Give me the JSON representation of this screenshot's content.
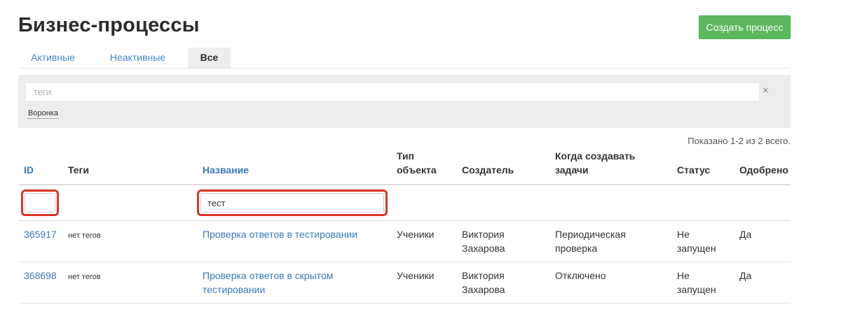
{
  "header": {
    "title": "Бизнес-процессы",
    "create_button": "Создать процесс"
  },
  "tabs": [
    {
      "label": "Активные",
      "active": false
    },
    {
      "label": "Неактивные",
      "active": false
    },
    {
      "label": "Все",
      "active": true
    }
  ],
  "filter": {
    "tags_placeholder": "теги",
    "clear_symbol": "×",
    "funnel_tag": "Воронка"
  },
  "summary": "Показано 1-2 из 2 всего.",
  "table": {
    "columns": {
      "id": "ID",
      "tags": "Теги",
      "name": "Название",
      "object_type": "Тип объекта",
      "creator": "Создатель",
      "when": "Когда создавать задачи",
      "status": "Статус",
      "approved": "Одобрено"
    },
    "filters": {
      "id_value": "",
      "name_value": "тест"
    },
    "rows": [
      {
        "id": "365917",
        "tags": "нет тегов",
        "name": "Проверка ответов в тестировании",
        "object_type": "Ученики",
        "creator": "Виктория Захарова",
        "when": "Периодическая проверка",
        "status": "Не запущен",
        "approved": "Да"
      },
      {
        "id": "368698",
        "tags": "нет тегов",
        "name": "Проверка ответов в скрытом тестировании",
        "object_type": "Ученики",
        "creator": "Виктория Захарова",
        "when": "Отключено",
        "status": "Не запущен",
        "approved": "Да"
      }
    ]
  },
  "colors": {
    "accent_link": "#3a78b8",
    "create_button": "#5cb85c",
    "highlight_box": "#d9352a"
  }
}
